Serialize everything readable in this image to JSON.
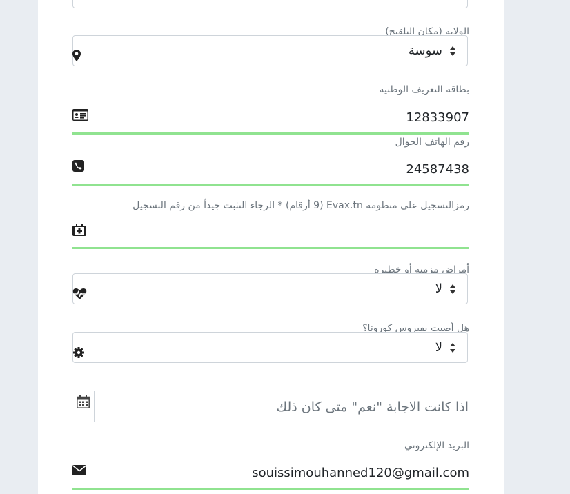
{
  "form": {
    "governorate": {
      "label": "الولاية (مكان التلقيح)",
      "value": "سوسة"
    },
    "national_id": {
      "label": "بطاقة التعريف الوطنية",
      "value": "12833907"
    },
    "phone": {
      "label": "رقم الهاتف الجوال",
      "value": "24587438"
    },
    "evax_code": {
      "label": "رمزالتسجيل على منظومة Evax.tn (9 أرقام) * الرجاء التثبت جيداً من رقم التسجيل",
      "value": ""
    },
    "chronic": {
      "label": "أمراض مزمنة أو خطيرة",
      "value": "لا"
    },
    "covid": {
      "label": "هل أصبت بفيروس كورونا؟",
      "value": "لا"
    },
    "covid_date": {
      "placeholder": "اذا كانت الاجابة \"نعم\" متى كان ذلك"
    },
    "email": {
      "label": "البريد الإلكتروني",
      "value": "souissimouhanned120@gmail.com"
    }
  },
  "colors": {
    "underline": "#90e390",
    "label": "#6c757d"
  },
  "icons": [
    "map-marker-icon",
    "id-card-icon",
    "phone-icon",
    "medkit-icon",
    "heartbeat-icon",
    "gear-icon",
    "calendar-icon",
    "envelope-icon",
    "sort-caret-icon"
  ]
}
